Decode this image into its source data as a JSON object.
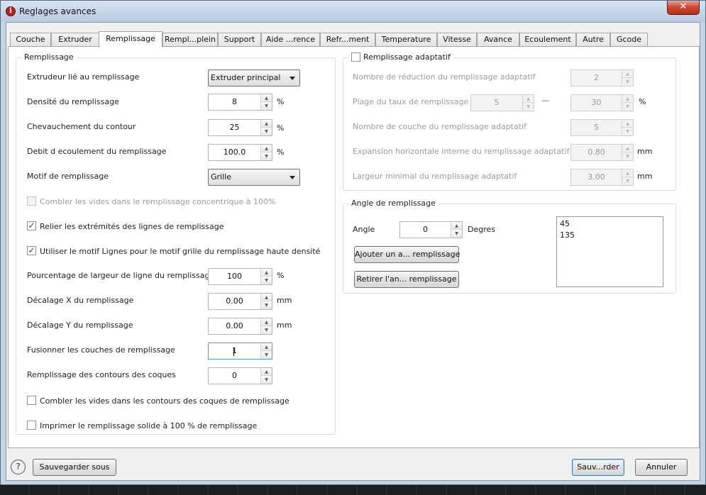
{
  "window": {
    "title": "Reglages avances",
    "close_label": "✕"
  },
  "tabs": [
    {
      "label": "Couche"
    },
    {
      "label": "Extruder"
    },
    {
      "label": "Remplissage"
    },
    {
      "label": "Rempl...plein"
    },
    {
      "label": "Support"
    },
    {
      "label": "Aide ...rence"
    },
    {
      "label": "Refr...ment"
    },
    {
      "label": "Temperature"
    },
    {
      "label": "Vitesse"
    },
    {
      "label": "Avance"
    },
    {
      "label": "Ecoulement"
    },
    {
      "label": "Autre"
    },
    {
      "label": "Gcode"
    }
  ],
  "active_tab": "Remplissage",
  "remplissage": {
    "group_title": "Remplissage",
    "extruder_label": "Extrudeur lié au remplissage",
    "extruder_value": "Extruder principal",
    "density_label": "Densité du remplissage",
    "density_value": "8",
    "density_unit": "%",
    "overlap_label": "Chevauchement du contour",
    "overlap_value": "25",
    "overlap_unit": "%",
    "flow_label": "Debit d ecoulement du remplissage",
    "flow_value": "100.0",
    "flow_unit": "%",
    "pattern_label": "Motif de remplissage",
    "pattern_value": "Grille",
    "concentric_fill_label": "Combler les vides dans le remplissage concentrique à 100%",
    "connect_lines_label": "Relier les extrémités des lignes de remplissage",
    "use_lines_label": "Utiliser le motif Lignes pour le motif grille du remplissage haute densité",
    "line_width_label": "Pourcentage de largeur de ligne du remplissage",
    "line_width_value": "100",
    "line_width_unit": "%",
    "offset_x_label": "Décalage X du remplissage",
    "offset_x_value": "0.00",
    "offset_x_unit": "mm",
    "offset_y_label": "Décalage Y du remplissage",
    "offset_y_value": "0.00",
    "offset_y_unit": "mm",
    "merge_layers_label": "Fusionner les couches de remplissage",
    "merge_layers_value": "1",
    "shell_fill_label": "Remplissage des contours des coques",
    "shell_fill_value": "0",
    "shell_gaps_label": "Combler les vides dans les contours des coques de remplissage",
    "solid_fill_label": "Imprimer le remplissage solide à 100 % de remplissage"
  },
  "adaptatif": {
    "group_title": "Remplissage adaptatif",
    "reduction_label": "Nombre de réduction du remplissage adaptatif",
    "reduction_value": "2",
    "range_label": "Plage du taux de remplissage",
    "range_min": "5",
    "range_dash": "—",
    "range_max": "30",
    "range_unit": "%",
    "layers_label": "Nombre de couche du remplissage adaptatif",
    "layers_value": "5",
    "expansion_label": "Expansion horizontale interne du remplissage adaptatif",
    "expansion_value": "0.80",
    "expansion_unit": "mm",
    "min_width_label": "Largeur minimal du remplissage adaptatif",
    "min_width_value": "3.00",
    "min_width_unit": "mm"
  },
  "angle": {
    "group_title": "Angle de remplissage",
    "angle_label": "Angle",
    "angle_value": "0",
    "angle_unit": "Degres",
    "add_button": "Ajouter un a... remplissage",
    "remove_button": "Retirer l'an... remplissage",
    "list": [
      "45",
      "135"
    ]
  },
  "footer": {
    "help_glyph": "?",
    "save_as_button": "Sauvegarder sous",
    "save_button": "Sauv...rder",
    "cancel_button": "Annuler"
  }
}
